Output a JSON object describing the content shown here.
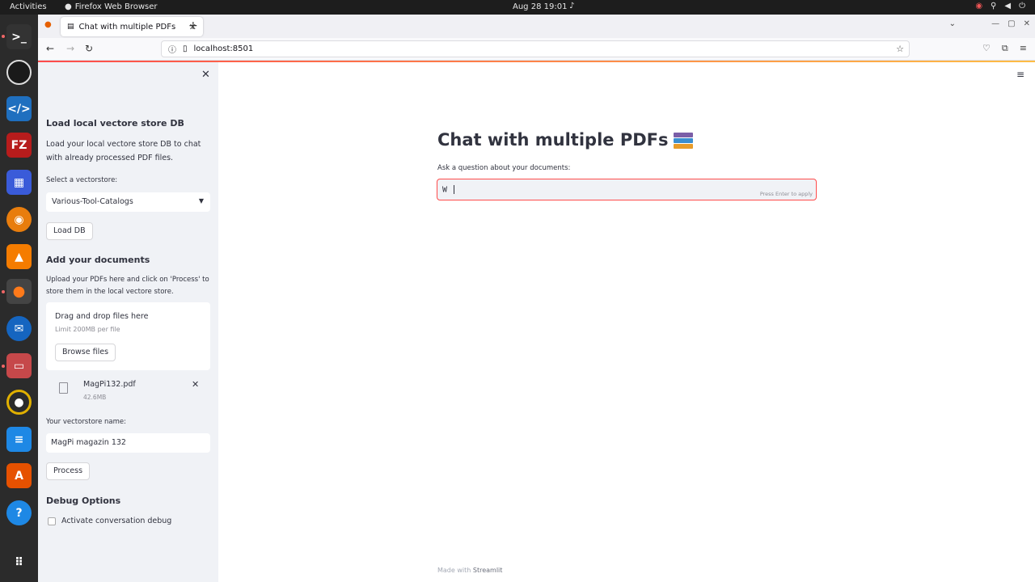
{
  "system": {
    "activities": "Activities",
    "app_name": "Firefox Web Browser",
    "clock": "Aug 28  19:01"
  },
  "browser": {
    "tab_title": "Chat with multiple PDFs",
    "url": "localhost:8501"
  },
  "sidebar": {
    "load_heading": "Load local vectore store DB",
    "load_desc": "Load your local vectore store DB to chat with already processed PDF files.",
    "select_label": "Select a vectorstore:",
    "select_value": "Various-Tool-Catalogs",
    "load_button": "Load DB",
    "add_heading": "Add your documents",
    "add_desc": "Upload your PDFs here and click on 'Process' to store them in the local vectore store.",
    "dropzone_title": "Drag and drop files here",
    "dropzone_limit": "Limit 200MB per file",
    "browse_button": "Browse files",
    "file_name": "MagPi132.pdf",
    "file_size": "42.6MB",
    "name_label": "Your vectorstore name:",
    "name_value": "MagPi magazin 132",
    "process_button": "Process",
    "debug_heading": "Debug Options",
    "debug_checkbox": "Activate conversation debug"
  },
  "main": {
    "title": "Chat with multiple PDFs",
    "question_label": "Ask a question about your documents:",
    "question_value": "W",
    "input_hint": "Press Enter to apply",
    "footer_prefix": "Made with",
    "footer_brand": "Streamlit"
  },
  "colors": {
    "accent": "#ff4b4b",
    "sidebar_bg": "#f0f2f6",
    "text": "#31333f"
  }
}
